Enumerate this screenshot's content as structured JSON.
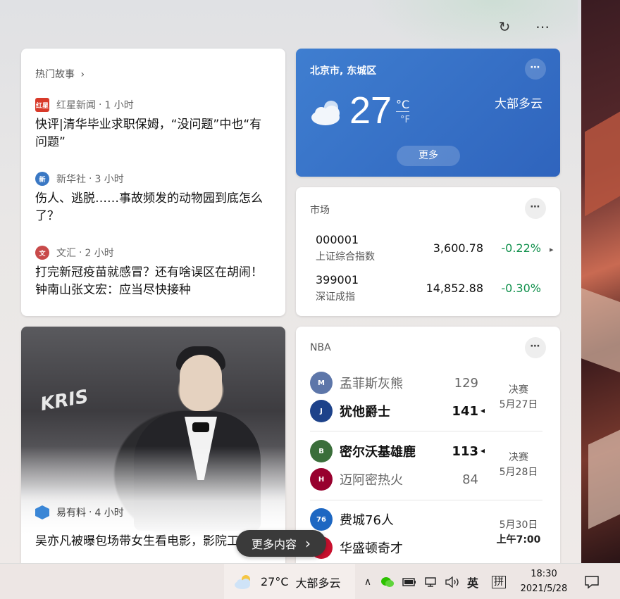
{
  "header": {
    "refresh_icon": "↻",
    "more_icon": "⋯"
  },
  "top_stories": {
    "title": "热门故事",
    "chevron": "›",
    "items": [
      {
        "source": "红星新闻",
        "time": "1 小时",
        "headline": "快评|清华毕业求职保姆，“没问题”中也“有问题”",
        "logo_text": "红星",
        "logo_color": "#d83a2a"
      },
      {
        "source": "新华社",
        "time": "3 小时",
        "headline": "伤人、逃脱……事故频发的动物园到底怎么了？",
        "logo_text": "新",
        "logo_color": "#3a78c4"
      },
      {
        "source": "文汇",
        "time": "2 小时",
        "headline": "打完新冠疫苗就感冒？还有啥误区在胡闹！钟南山张文宏：应当尽快接种",
        "logo_text": "文",
        "logo_color": "#c84a4a"
      }
    ]
  },
  "weather": {
    "location": "北京市, 东城区",
    "temp": "27",
    "unit_c": "°C",
    "unit_f": "°F",
    "condition": "大部多云",
    "more": "更多",
    "more_icon": "⋯"
  },
  "market": {
    "title": "市场",
    "more_icon": "⋯",
    "next_icon": "▸",
    "rows": [
      {
        "code": "000001",
        "name": "上证综合指数",
        "price": "3,600.78",
        "change": "-0.22%"
      },
      {
        "code": "399001",
        "name": "深证成指",
        "price": "14,852.88",
        "change": "-0.30%"
      }
    ]
  },
  "nba": {
    "title": "NBA",
    "more_icon": "⋯",
    "arrow_icon": "◂",
    "games": [
      {
        "teams": [
          {
            "name": "孟菲斯灰熊",
            "score": "129",
            "logo": "M",
            "color": "#5d76a9",
            "win": false
          },
          {
            "name": "犹他爵士",
            "score": "141",
            "logo": "J",
            "color": "#1d428a",
            "win": true
          }
        ],
        "stage": "决赛",
        "date": "5月27日"
      },
      {
        "teams": [
          {
            "name": "密尔沃基雄鹿",
            "score": "113",
            "logo": "B",
            "color": "#3a6e3a",
            "win": true
          },
          {
            "name": "迈阿密热火",
            "score": "84",
            "logo": "H",
            "color": "#98002e",
            "win": false
          }
        ],
        "stage": "决赛",
        "date": "5月28日"
      },
      {
        "teams": [
          {
            "name": "费城76人",
            "score": "",
            "logo": "76",
            "color": "#1d67c2",
            "win": false
          },
          {
            "name": "华盛顿奇才",
            "score": "",
            "logo": "W",
            "color": "#c8102e",
            "win": false
          }
        ],
        "date": "5月30日",
        "time": "上午7:00"
      }
    ]
  },
  "photo_story": {
    "source": "易有料",
    "time": "4 小时",
    "sign_text": "KRIS",
    "headline": "吴亦凡被曝包场带女生看电影，影院工作人员公开监控视频引热议"
  },
  "more_content": {
    "label": "更多内容",
    "chevron": "›"
  },
  "taskbar": {
    "temp": "27°C",
    "condition": "大部多云",
    "tray_up": "∧",
    "ime_lang": "英",
    "ime_mode": "拼",
    "time": "18:30",
    "date": "2021/5/28",
    "notification_icon": "▢"
  }
}
